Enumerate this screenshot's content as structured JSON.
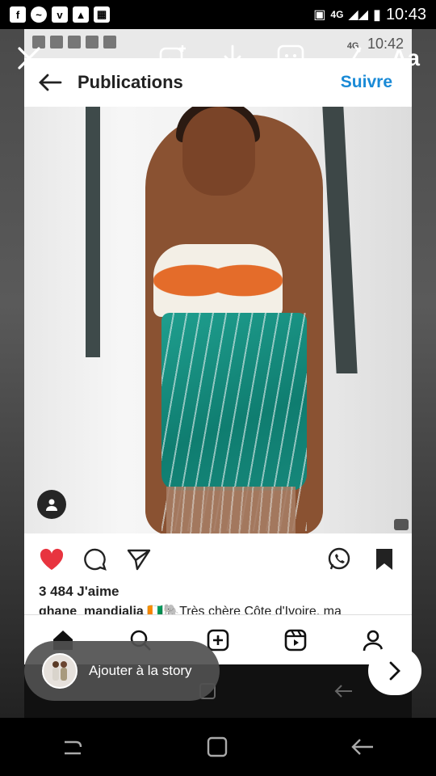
{
  "status_bar": {
    "time": "10:43",
    "network": "4G",
    "notification_icons": [
      "facebook-icon",
      "messenger-icon",
      "vimeo-icon",
      "gallery-icon",
      "app-icon"
    ]
  },
  "story_editor": {
    "tools": [
      "close-icon",
      "sticker-photo-icon",
      "download-icon",
      "sticker-icon",
      "draw-icon",
      "text-icon"
    ],
    "text_tool_label": "Aa",
    "add_to_story_label": "Ajouter à la story"
  },
  "inner_screen": {
    "status_time": "10:42",
    "status_network": "4G",
    "header": {
      "title": "Publications",
      "follow_label": "Suivre"
    },
    "post": {
      "likes": "3 484 J'aime",
      "caption_user": "ghane_mandialia",
      "caption_text": "🇨🇮🐘Très chère Côte d'Ivoire, ma"
    },
    "nav_icons": [
      "home-icon",
      "search-icon",
      "add-post-icon",
      "reels-icon",
      "profile-icon"
    ]
  },
  "colors": {
    "accent": "#1a8ad6",
    "like": "#e8343f",
    "dress": "#16877a"
  }
}
